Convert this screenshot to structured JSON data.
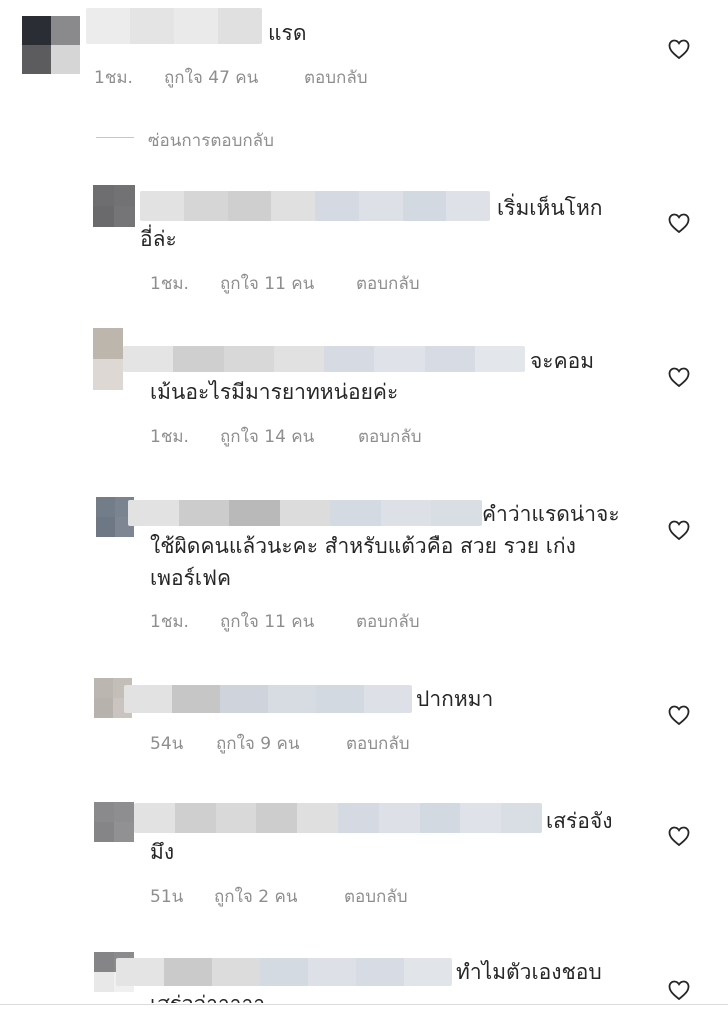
{
  "hide_replies_label": "ซ่อนการตอบกลับ",
  "colors": {
    "text": "#262626",
    "meta": "#8e8e8e"
  },
  "comments": [
    {
      "lines": [
        "แรด"
      ],
      "time": "1ชม.",
      "likes": "ถูกใจ 47 คน",
      "reply": "ตอบกลับ"
    },
    {
      "lines": [
        "เริ่มเห็นโหก",
        "อี่ล่ะ"
      ],
      "time": "1ชม.",
      "likes": "ถูกใจ 11 คน",
      "reply": "ตอบกลับ"
    },
    {
      "lines": [
        "จะคอม",
        "เม้นอะไรมีมารยาทหน่อยค่ะ"
      ],
      "time": "1ชม.",
      "likes": "ถูกใจ 14 คน",
      "reply": "ตอบกลับ"
    },
    {
      "lines": [
        "คำว่าแรดน่าจะ",
        "ใช้ผิดคนแล้วนะคะ สำหรับแต้วคือ สวย รวย เก่ง",
        "เพอร์เฟค"
      ],
      "time": "1ชม.",
      "likes": "ถูกใจ 11 คน",
      "reply": "ตอบกลับ"
    },
    {
      "lines": [
        "ปากหมา"
      ],
      "time": "54น",
      "likes": "ถูกใจ 9 คน",
      "reply": "ตอบกลับ"
    },
    {
      "lines": [
        "เสร่อจัง",
        "มึง"
      ],
      "time": "51น",
      "likes": "ถูกใจ 2 คน",
      "reply": "ตอบกลับ"
    },
    {
      "lines": [
        "ทำไมตัวเองชอบ",
        "เสร่อจ่าาาาา"
      ]
    }
  ]
}
